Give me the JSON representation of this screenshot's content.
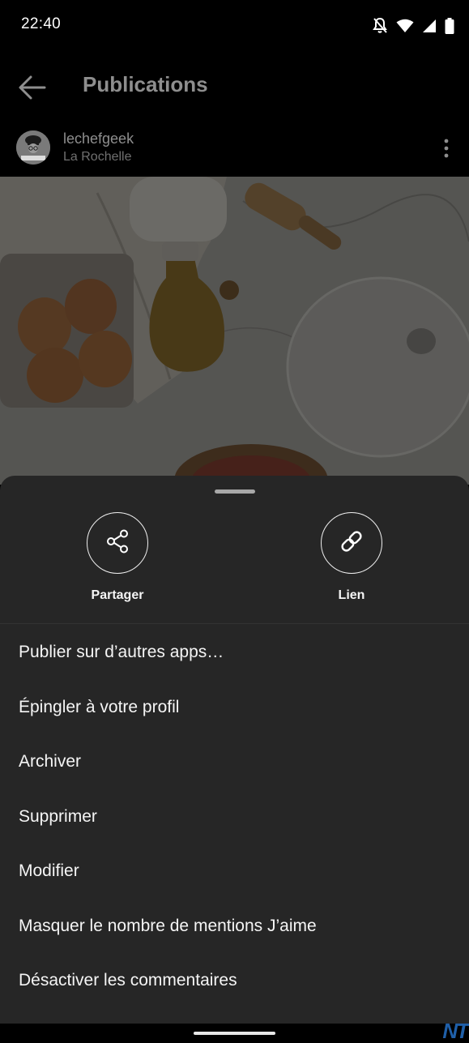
{
  "status_bar": {
    "time": "22:40",
    "icons": [
      "notifications-off-icon",
      "wifi-icon",
      "signal-icon",
      "battery-icon"
    ]
  },
  "header": {
    "title": "Publications",
    "back_icon": "back-arrow-icon"
  },
  "post": {
    "username": "lechefgeek",
    "location": "La Rochelle",
    "avatar_text": "LeChefGeek",
    "more_icon": "more-vertical-icon"
  },
  "sheet": {
    "actions": [
      {
        "label": "Partager",
        "icon": "share-icon"
      },
      {
        "label": "Lien",
        "icon": "link-icon"
      }
    ],
    "menu_items": [
      "Publier sur d’autres apps…",
      "Épingler à votre profil",
      "Archiver",
      "Supprimer",
      "Modifier",
      "Masquer le nombre de mentions J’aime",
      "Désactiver les commentaires"
    ]
  },
  "watermark": "NT",
  "colors": {
    "sheet_background": "#262626",
    "page_background": "#000000",
    "dimmed_text": "#8e8e8e"
  }
}
